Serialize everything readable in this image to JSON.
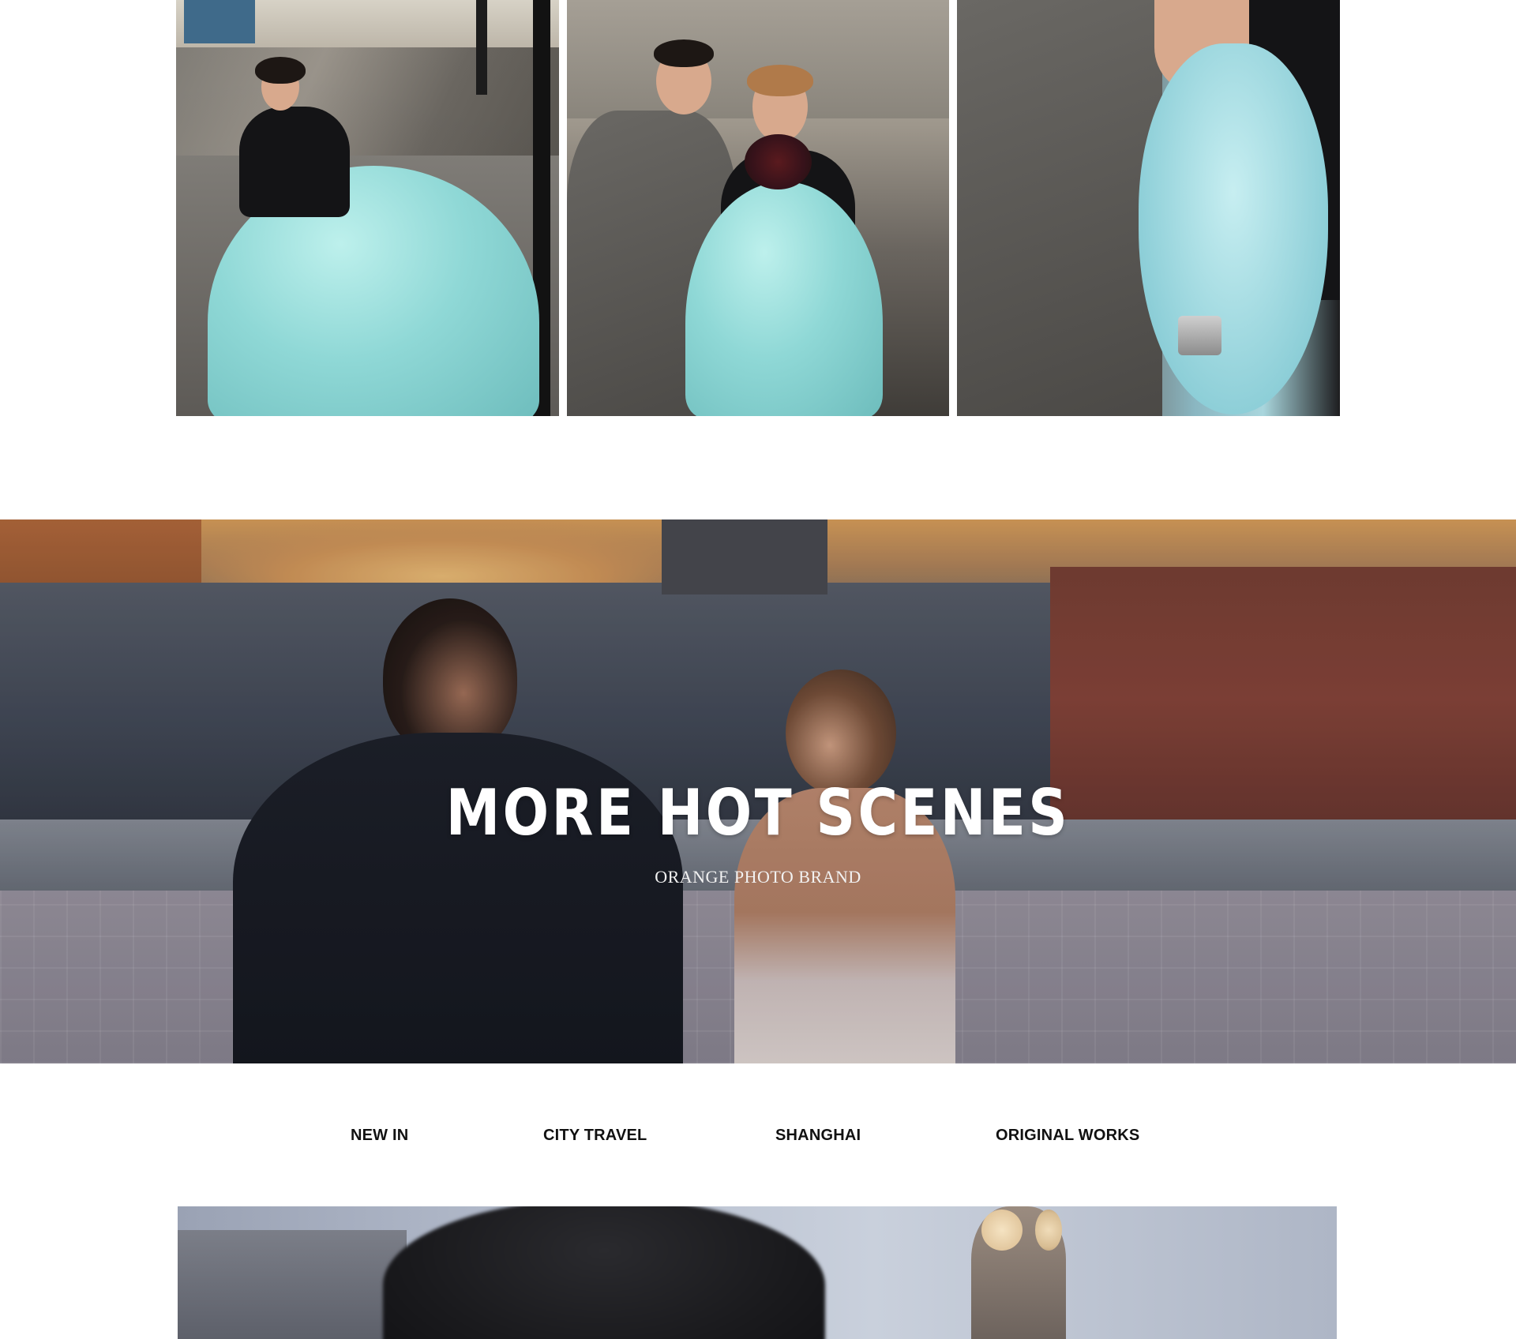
{
  "gallery": {
    "photos": [
      {
        "icon": "photo-bride-street-gown"
      },
      {
        "icon": "photo-couple-bouquet"
      },
      {
        "icon": "photo-couple-bow-camera"
      }
    ]
  },
  "banner": {
    "title": "MORE HOT SCENES",
    "subtitle": "ORANGE PHOTO BRAND"
  },
  "category_nav": {
    "items": [
      {
        "label": "NEW IN"
      },
      {
        "label": "CITY TRAVEL"
      },
      {
        "label": "SHANGHAI"
      },
      {
        "label": "ORIGINAL WORKS"
      }
    ]
  },
  "preview": {
    "icon": "photo-couple-clock-tower"
  },
  "colors": {
    "background": "#ffffff",
    "nav_text": "#111111",
    "banner_text": "#ffffff",
    "gown_accent": "#8fd8d6"
  }
}
